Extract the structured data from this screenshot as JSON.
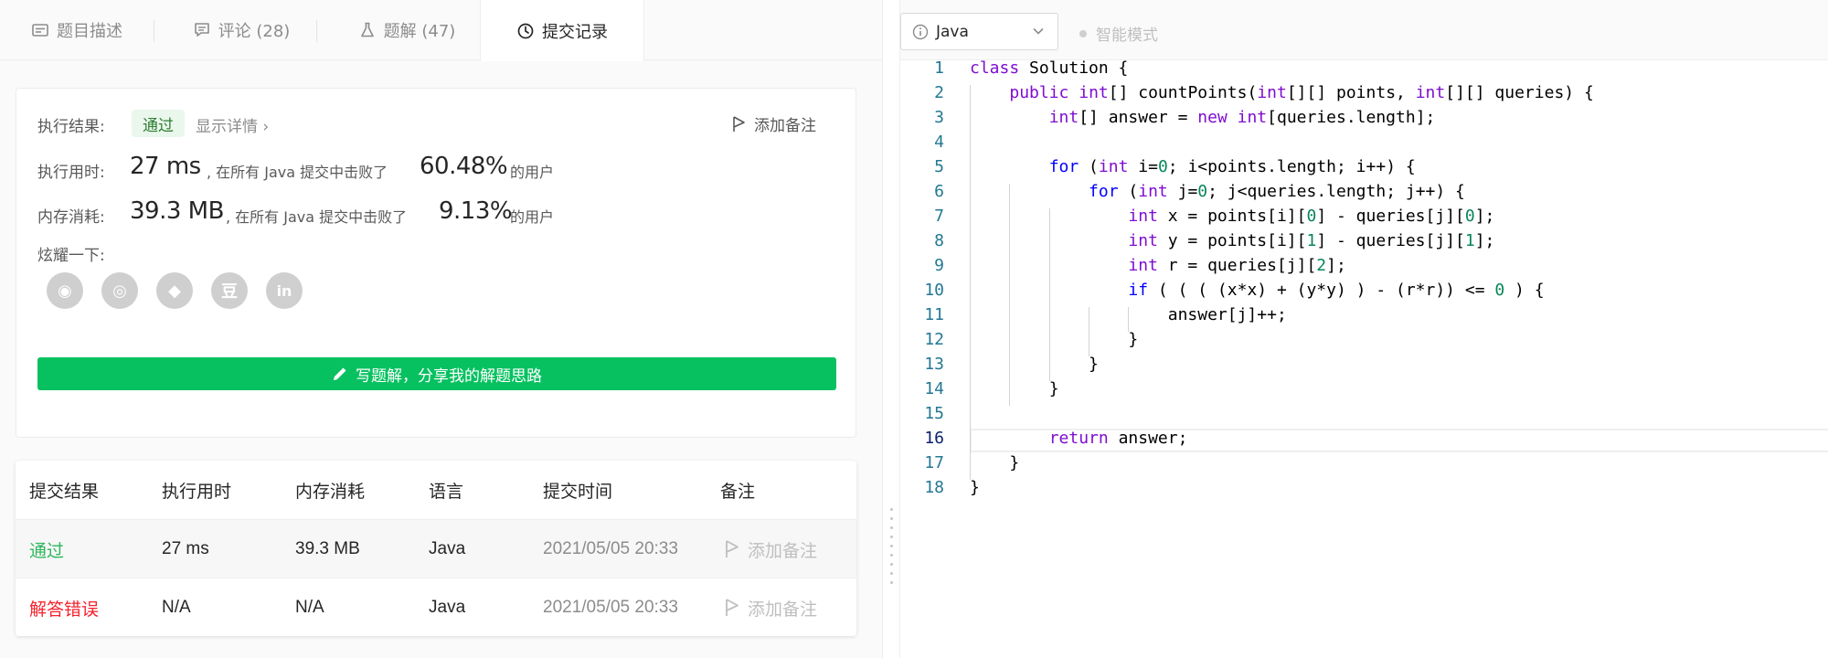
{
  "tabs": [
    {
      "label": "题目描述",
      "icon": "description-icon"
    },
    {
      "label": "评论 (28)",
      "icon": "comment-icon"
    },
    {
      "label": "题解 (47)",
      "icon": "flask-icon"
    },
    {
      "label": "提交记录",
      "icon": "clock-icon",
      "active": true
    }
  ],
  "result": {
    "label": "执行结果:",
    "status": "通过",
    "detail_link": "显示详情 ›",
    "add_note": "添加备注",
    "runtime_label": "执行用时:",
    "runtime_value": "27 ms",
    "runtime_beat_text": ", 在所有 Java 提交中击败了",
    "runtime_percent": "60.48%",
    "users_suffix": "的用户",
    "memory_label": "内存消耗:",
    "memory_value": "39.3 MB",
    "memory_beat_text": ", 在所有 Java 提交中击败了",
    "memory_percent": "9.13%",
    "share_label": "炫耀一下:",
    "social_icons": [
      "wechat-icon",
      "weibo-icon",
      "qq-icon",
      "douban-icon",
      "linkedin-icon"
    ],
    "social_glyphs": [
      "◉",
      "◎",
      "◆",
      "豆",
      "in"
    ],
    "write_button": "写题解，分享我的解题思路"
  },
  "submissions": {
    "headers": [
      "提交结果",
      "执行用时",
      "内存消耗",
      "语言",
      "提交时间",
      "备注"
    ],
    "rows": [
      {
        "result": "通过",
        "runtime": "27 ms",
        "memory": "39.3 MB",
        "language": "Java",
        "time": "2021/05/05 20:33",
        "note": "添加备注"
      },
      {
        "result": "解答错误",
        "runtime": "N/A",
        "memory": "N/A",
        "language": "Java",
        "time": "2021/05/05 20:33",
        "note": "添加备注"
      }
    ]
  },
  "editor": {
    "language": "Java",
    "smart_mode": "智能模式",
    "current_line": 16,
    "lines": [
      "class Solution {",
      "    public int[] countPoints(int[][] points, int[][] queries) {",
      "        int[] answer = new int[queries.length];",
      "",
      "        for (int i=0; i<points.length; i++) {",
      "            for (int j=0; j<queries.length; j++) {",
      "                int x = points[i][0] - queries[j][0];",
      "                int y = points[i][1] - queries[j][1];",
      "                int r = queries[j][2];",
      "                if ( ( ( (x*x) + (y*y) ) - (r*r)) <= 0 ) {",
      "                    answer[j]++;",
      "                }",
      "            }",
      "        }",
      "",
      "        return answer;",
      "    }",
      "}"
    ]
  },
  "colors": {
    "keyword": "#7f0dd1",
    "keyword_blue": "#0000ff",
    "number": "#098658",
    "accent_green": "#07c160",
    "pass": "#2db55d",
    "error": "#f5222d"
  }
}
